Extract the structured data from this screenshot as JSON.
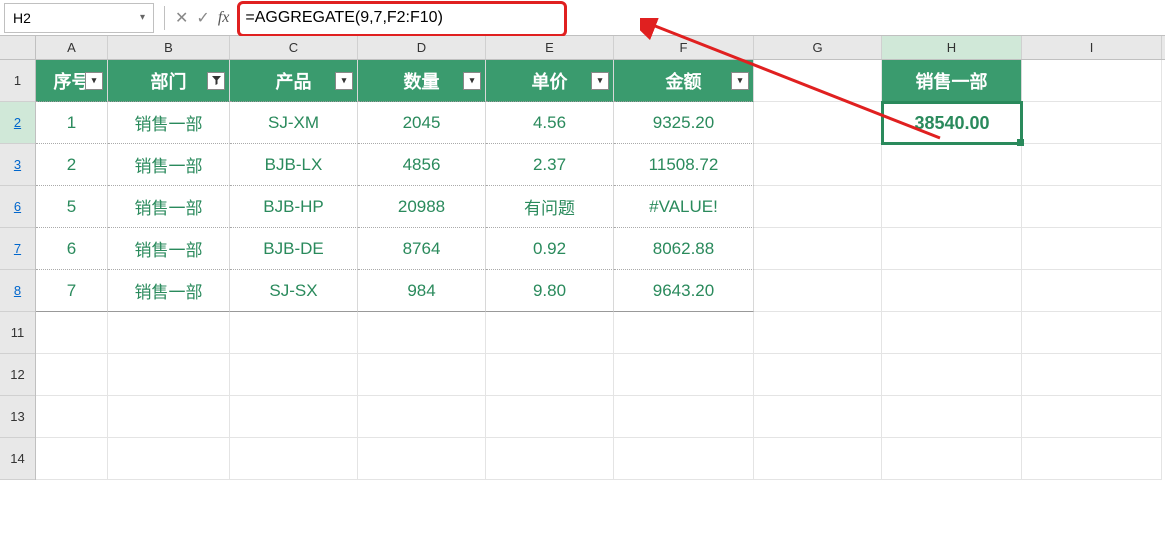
{
  "name_box": "H2",
  "formula": "=AGGREGATE(9,7,F2:F10)",
  "columns": [
    "A",
    "B",
    "C",
    "D",
    "E",
    "F",
    "G",
    "H",
    "I"
  ],
  "row_numbers": [
    "1",
    "2",
    "3",
    "6",
    "7",
    "8",
    "11",
    "12",
    "13",
    "14"
  ],
  "headers": {
    "seq": "序号",
    "dept": "部门",
    "product": "产品",
    "qty": "数量",
    "price": "单价",
    "amount": "金额"
  },
  "summary": {
    "label": "销售一部",
    "value": "38540.00"
  },
  "rows": [
    {
      "seq": "1",
      "dept": "销售一部",
      "product": "SJ-XM",
      "qty": "2045",
      "price": "4.56",
      "amount": "9325.20"
    },
    {
      "seq": "2",
      "dept": "销售一部",
      "product": "BJB-LX",
      "qty": "4856",
      "price": "2.37",
      "amount": "11508.72"
    },
    {
      "seq": "5",
      "dept": "销售一部",
      "product": "BJB-HP",
      "qty": "20988",
      "price": "有问题",
      "amount": "#VALUE!"
    },
    {
      "seq": "6",
      "dept": "销售一部",
      "product": "BJB-DE",
      "qty": "8764",
      "price": "0.92",
      "amount": "8062.88"
    },
    {
      "seq": "7",
      "dept": "销售一部",
      "product": "SJ-SX",
      "qty": "984",
      "price": "9.80",
      "amount": "9643.20"
    }
  ],
  "chart_data": {
    "type": "table",
    "title": "销售一部 产品金额",
    "columns": [
      "序号",
      "部门",
      "产品",
      "数量",
      "单价",
      "金额"
    ],
    "data": [
      [
        1,
        "销售一部",
        "SJ-XM",
        2045,
        4.56,
        9325.2
      ],
      [
        2,
        "销售一部",
        "BJB-LX",
        4856,
        2.37,
        11508.72
      ],
      [
        5,
        "销售一部",
        "BJB-HP",
        20988,
        "有问题",
        "#VALUE!"
      ],
      [
        6,
        "销售一部",
        "BJB-DE",
        8764,
        0.92,
        8062.88
      ],
      [
        7,
        "销售一部",
        "SJ-SX",
        984,
        9.8,
        9643.2
      ]
    ],
    "aggregate": {
      "formula": "AGGREGATE(9,7,F2:F10)",
      "result": 38540.0
    }
  }
}
